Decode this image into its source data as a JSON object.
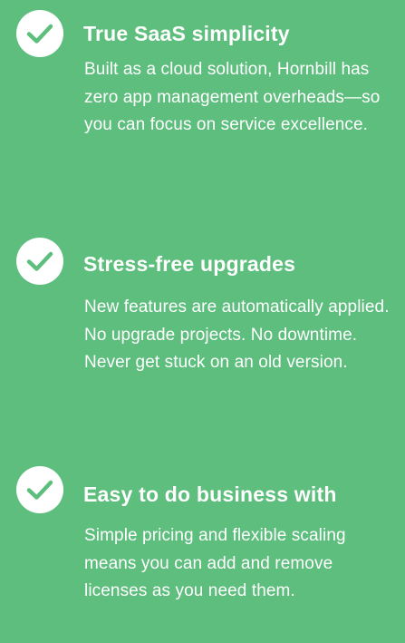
{
  "features": [
    {
      "icon": "checkmark-icon",
      "title": "True SaaS simplicity",
      "description": "Built as a cloud solution, Hornbill has zero app management overheads—so you can focus on service excellence."
    },
    {
      "icon": "checkmark-icon",
      "title": "Stress-free upgrades",
      "description": "New features are automatically applied. No upgrade projects. No downtime. Never get stuck on an old version."
    },
    {
      "icon": "checkmark-icon",
      "title": "Easy to do business with",
      "description": "Simple pricing and flexible scaling means you can add and remove licenses as you need them."
    }
  ],
  "colors": {
    "background": "#5dbe7d",
    "icon_circle": "#ffffff",
    "icon_check": "#5dbe7d",
    "text": "#ffffff"
  }
}
